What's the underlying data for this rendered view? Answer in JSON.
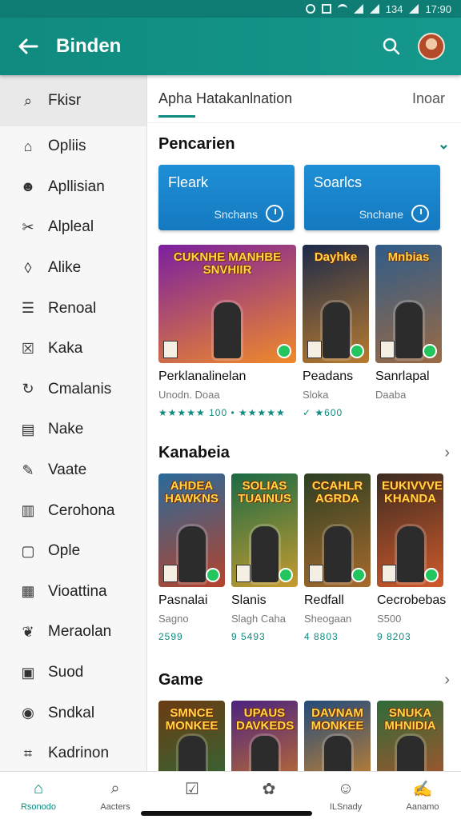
{
  "status": {
    "battery": "134",
    "time": "17:90"
  },
  "appbar": {
    "title": "Binden"
  },
  "drawer": {
    "items": [
      {
        "icon": "search-icon",
        "label": "Fkisr"
      },
      {
        "icon": "home-icon",
        "label": "Opliis"
      },
      {
        "icon": "person-icon",
        "label": "Apllisian"
      },
      {
        "icon": "tools-icon",
        "label": "Alpleal"
      },
      {
        "icon": "shapes-icon",
        "label": "Alike"
      },
      {
        "icon": "list-icon",
        "label": "Renoal"
      },
      {
        "icon": "box-icon",
        "label": "Kaka"
      },
      {
        "icon": "loop-icon",
        "label": "Cmalanis"
      },
      {
        "icon": "doc-icon",
        "label": "Nake"
      },
      {
        "icon": "edit-icon",
        "label": "Vaate"
      },
      {
        "icon": "bag-icon",
        "label": "Cerohona"
      },
      {
        "icon": "frame-icon",
        "label": "Ople"
      },
      {
        "icon": "calendar-icon",
        "label": "Vioattina"
      },
      {
        "icon": "leaf-icon",
        "label": "Meraolan"
      },
      {
        "icon": "grid-icon",
        "label": "Suod"
      },
      {
        "icon": "eye-icon",
        "label": "Sndkal"
      },
      {
        "icon": "tag-icon",
        "label": "Kadrinon"
      }
    ]
  },
  "tabs": {
    "left": "Apha Hatakanlnation",
    "right": "Inoar"
  },
  "sections": {
    "pencarian": {
      "title": "Pencarien",
      "cards": [
        {
          "title": "Fleark",
          "sub": "Snchans"
        },
        {
          "title": "Soarlcs",
          "sub": "Snchane"
        }
      ]
    },
    "top": {
      "games": [
        {
          "name": "Perklanalinelan",
          "sub": "Unodn. Doaa",
          "rate": "★★★★★ 100  •  ★★★★★",
          "logo": "CUKNHE  MANHBE SNVHIIR",
          "c1": "#7a1fa0",
          "c2": "#f08a2a"
        },
        {
          "name": "Peadans",
          "sub": "Sloka",
          "rate": "✓ ★600",
          "logo": "Dayhke",
          "c1": "#1c2a4a",
          "c2": "#b87b2f"
        },
        {
          "name": "Sanrlapal",
          "sub": "Daaba",
          "rate": "",
          "logo": "Mnbias",
          "c1": "#2e5c8a",
          "c2": "#9b6a43"
        }
      ]
    },
    "kanabeia": {
      "title": "Kanabeia",
      "games": [
        {
          "name": "Pasnalai",
          "sub": "Sagno",
          "rate": "2599",
          "logo": "AHDEA HAWKNS",
          "c1": "#2a6a9a",
          "c2": "#b4432c"
        },
        {
          "name": "Slanis",
          "sub": "Slagh Caha",
          "rate": "9 5493",
          "logo": "SOLIAS TUAINUS",
          "c1": "#1a6a45",
          "c2": "#c79b2f"
        },
        {
          "name": "Redfall",
          "sub": "Sheogaan",
          "rate": "4 8803",
          "logo": "CCAHLR AGRDA",
          "c1": "#2b3f23",
          "c2": "#a76a2d"
        },
        {
          "name": "Cecrobebas",
          "sub": "S500",
          "rate": "9 8203",
          "logo": "EUKIVVVE KHANDA",
          "c1": "#3b2b22",
          "c2": "#d05a2a"
        }
      ]
    },
    "game": {
      "title": "Game",
      "games": [
        {
          "logo": "SMNCE MONKEE",
          "c1": "#6b3b13",
          "c2": "#2d6b3a"
        },
        {
          "logo": "UPAUS DAVKEDS",
          "c1": "#4b2380",
          "c2": "#c9752a"
        },
        {
          "logo": "DAVNAM MONKEE",
          "c1": "#224b7c",
          "c2": "#d5872a"
        },
        {
          "logo": "SNUKA MHNIDIA",
          "c1": "#2e6b3a",
          "c2": "#b4522a"
        }
      ]
    }
  },
  "bottom_nav": [
    {
      "icon": "home-icon",
      "label": "Rsonodo"
    },
    {
      "icon": "search-icon",
      "label": "Aacters"
    },
    {
      "icon": "check-box-icon",
      "label": ""
    },
    {
      "icon": "brain-icon",
      "label": ""
    },
    {
      "icon": "smile-box-icon",
      "label": "ILSnady"
    },
    {
      "icon": "note-edit-icon",
      "label": "Aanamo"
    }
  ]
}
